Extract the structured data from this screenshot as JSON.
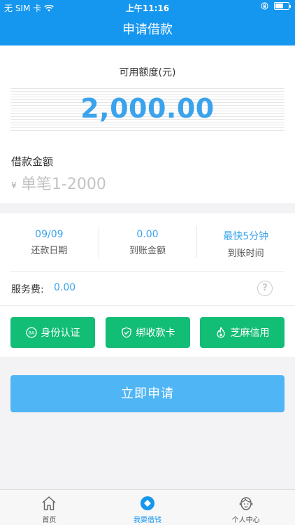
{
  "status_bar": {
    "carrier": "无 SIM 卡",
    "time": "上午11:16"
  },
  "header": {
    "title": "申请借款"
  },
  "quota": {
    "label": "可用额度(元)",
    "amount": "2,000.00"
  },
  "loan": {
    "title": "借款金额",
    "currency": "¥",
    "placeholder": "单笔1-2000"
  },
  "stats": [
    {
      "value": "09/09",
      "label": "还款日期"
    },
    {
      "value": "0.00",
      "label": "到账金额"
    },
    {
      "value": "最快5分钟",
      "label": "到账时间"
    }
  ],
  "fee": {
    "label": "服务费:",
    "value": "0.00",
    "help": "?"
  },
  "verify_buttons": [
    {
      "label": "身份认证",
      "icon": "id-icon"
    },
    {
      "label": "绑收款卡",
      "icon": "shield-check-icon"
    },
    {
      "label": "芝麻信用",
      "icon": "flame-icon"
    }
  ],
  "apply_button": {
    "label": "立即申请"
  },
  "tabs": [
    {
      "label": "首页",
      "icon": "home-icon"
    },
    {
      "label": "我要借钱",
      "icon": "loan-icon"
    },
    {
      "label": "个人中心",
      "icon": "person-icon"
    }
  ],
  "colors": {
    "primary": "#1596ef",
    "accent": "#3aa3ec",
    "green": "#12bd75",
    "apply": "#4fb5f5"
  }
}
